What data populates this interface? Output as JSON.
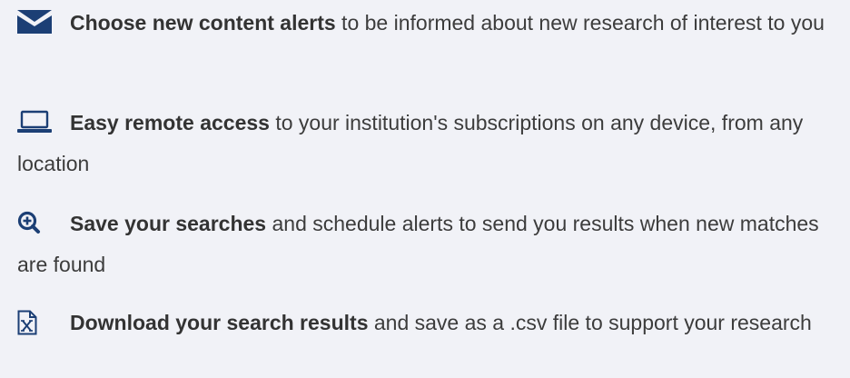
{
  "accent_color": "#1c3f75",
  "features": [
    {
      "icon": "envelope-icon",
      "title": "Choose new content alerts",
      "text": " to be informed about new research of interest to you"
    },
    {
      "icon": "laptop-icon",
      "title": "Easy remote access",
      "text": " to your institution's subscriptions on any device, from any location"
    },
    {
      "icon": "search-plus-icon",
      "title": "Save your searches",
      "text": " and schedule alerts to send you results when new matches are found"
    },
    {
      "icon": "excel-file-icon",
      "title": "Download your search results",
      "text": " and save as a .csv file to support your research"
    }
  ]
}
